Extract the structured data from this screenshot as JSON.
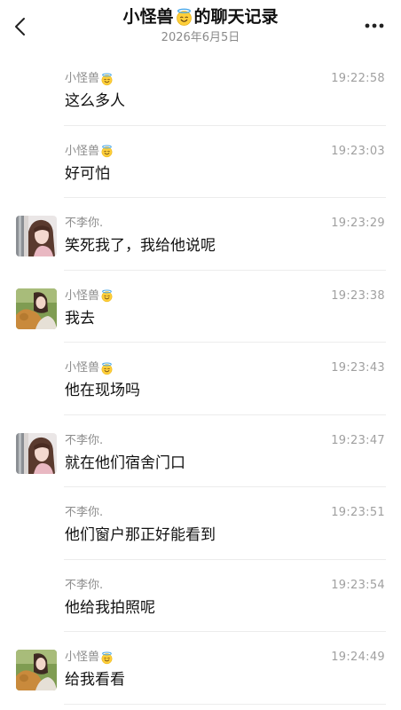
{
  "header": {
    "title": "小怪兽",
    "title_suffix": "的聊天记录",
    "date": "2026年6月5日",
    "back_icon": "chevron-left-icon",
    "more_icon": "more-dots-icon"
  },
  "messages": [
    {
      "sender": "小怪兽",
      "halo": true,
      "avatar": "none",
      "time": "19:22:58",
      "text": "这么多人"
    },
    {
      "sender": "小怪兽",
      "halo": true,
      "avatar": "none",
      "time": "19:23:03",
      "text": "好可怕"
    },
    {
      "sender": "不李你.",
      "halo": false,
      "avatar": "girl-pink",
      "time": "19:23:29",
      "text": "笑死我了，我给他说呢"
    },
    {
      "sender": "小怪兽",
      "halo": true,
      "avatar": "dog-girl",
      "time": "19:23:38",
      "text": "我去"
    },
    {
      "sender": "小怪兽",
      "halo": true,
      "avatar": "none",
      "time": "19:23:43",
      "text": "他在现场吗"
    },
    {
      "sender": "不李你.",
      "halo": false,
      "avatar": "girl-pink",
      "time": "19:23:47",
      "text": "就在他们宿舍门口"
    },
    {
      "sender": "不李你.",
      "halo": false,
      "avatar": "none",
      "time": "19:23:51",
      "text": "他们窗户那正好能看到"
    },
    {
      "sender": "不李你.",
      "halo": false,
      "avatar": "none",
      "time": "19:23:54",
      "text": "他给我拍照呢"
    },
    {
      "sender": "小怪兽",
      "halo": true,
      "avatar": "dog-girl",
      "time": "19:24:49",
      "text": "给我看看"
    }
  ]
}
